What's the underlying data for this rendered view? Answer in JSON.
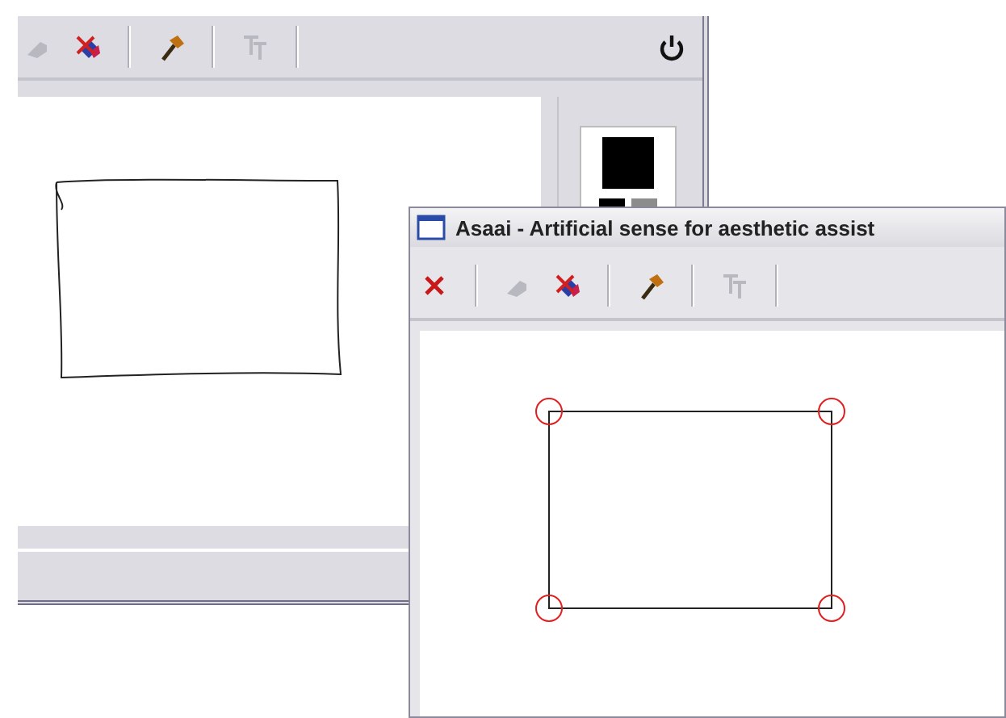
{
  "back_window": {
    "toolbar": [
      {
        "kind": "pen",
        "disabled": true
      },
      {
        "kind": "eraser",
        "disabled": false
      },
      {
        "kind": "separator"
      },
      {
        "kind": "hammer",
        "disabled": false
      },
      {
        "kind": "separator"
      },
      {
        "kind": "text",
        "disabled": true
      },
      {
        "kind": "separator"
      }
    ],
    "power_button": {
      "disabled": false
    },
    "swatches": [
      {
        "color": "#000000"
      },
      {
        "color": "#000000"
      },
      {
        "color": "#8c8c8c"
      }
    ],
    "shapes": [
      {
        "kind": "sketch"
      }
    ]
  },
  "front_window": {
    "title": "Asaai - Artificial sense for aesthetic assist",
    "toolbar": [
      {
        "kind": "delete",
        "disabled": false
      },
      {
        "kind": "separator"
      },
      {
        "kind": "pen",
        "disabled": true
      },
      {
        "kind": "eraser",
        "disabled": false
      },
      {
        "kind": "separator"
      },
      {
        "kind": "hammer",
        "disabled": false
      },
      {
        "kind": "separator"
      },
      {
        "kind": "text",
        "disabled": true
      },
      {
        "kind": "separator"
      }
    ],
    "shapes": [
      {
        "kind": "rectangle",
        "selected": true
      }
    ]
  }
}
